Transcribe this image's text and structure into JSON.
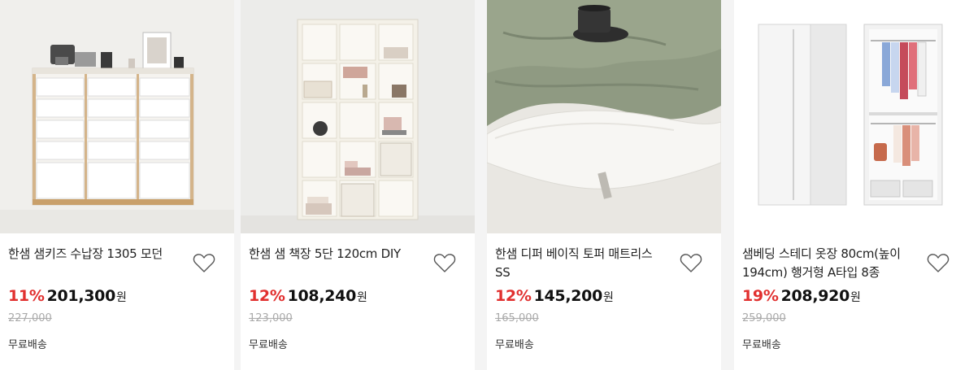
{
  "products": [
    {
      "title": "한샘 샘키즈 수납장 1305 모던",
      "discount": "11%",
      "price": "201,300",
      "currency": "원",
      "original_price": "227,000",
      "shipping": "무료배송"
    },
    {
      "title": "한샘 샘 책장 5단 120cm DIY",
      "discount": "12%",
      "price": "108,240",
      "currency": "원",
      "original_price": "123,000",
      "shipping": "무료배송"
    },
    {
      "title": "한샘 디퍼 베이직 토퍼 매트리스 SS",
      "discount": "12%",
      "price": "145,200",
      "currency": "원",
      "original_price": "165,000",
      "shipping": "무료배송"
    },
    {
      "title": "샘베딩 스테디 옷장 80cm(높이194cm) 행거형 A타입 8종",
      "discount": "19%",
      "price": "208,920",
      "currency": "원",
      "original_price": "259,000",
      "shipping": "무료배송"
    }
  ],
  "icons": {
    "wishlist": "heart-outline-icon"
  },
  "colors": {
    "discount": "#e1302f",
    "price": "#111111",
    "original_price": "#aaaaaa",
    "background": "#f4f4f4"
  }
}
